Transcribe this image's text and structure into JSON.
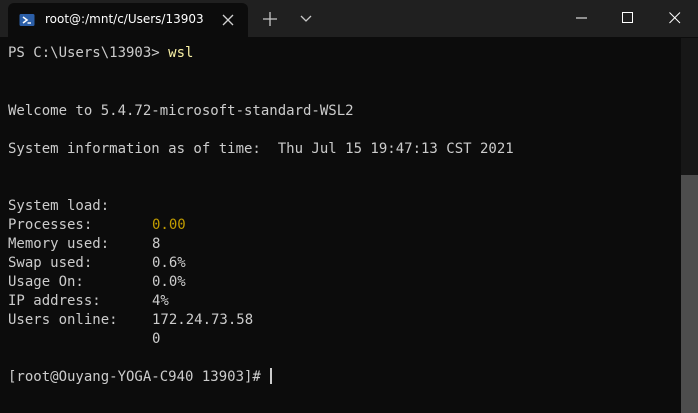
{
  "window": {
    "tab_title": "root@:/mnt/c/Users/13903",
    "icons": {
      "tab": "powershell-icon",
      "tab_close": "close-icon",
      "new_tab": "plus-icon",
      "dropdown": "chevron-down-icon",
      "minimize": "minimize-icon",
      "maximize": "maximize-icon",
      "close": "close-icon"
    }
  },
  "terminal": {
    "prompt_ps": "PS C:\\Users\\13903> ",
    "command": "wsl",
    "welcome": "Welcome to 5.4.72-microsoft-standard-WSL2",
    "sysinfo": "System information as of time:  Thu Jul 15 19:47:13 CST 2021",
    "info": [
      {
        "key": "System load:",
        "value": "0.00",
        "highlight": true
      },
      {
        "key": "Processes:",
        "value": "8",
        "highlight": false
      },
      {
        "key": "Memory used:",
        "value": "0.6%",
        "highlight": false
      },
      {
        "key": "Swap used:",
        "value": "0.0%",
        "highlight": false
      },
      {
        "key": "Usage On:",
        "value": "4%",
        "highlight": false
      },
      {
        "key": "IP address:",
        "value": "172.24.73.58",
        "highlight": false
      },
      {
        "key": "Users online:",
        "value": "0",
        "highlight": false
      }
    ],
    "final_prompt": "[root@Ouyang-YOGA-C940 13903]# "
  },
  "colors": {
    "background": "#0c0c0c",
    "titlebar": "#202020",
    "text": "#cccccc",
    "command": "#f9f1a5",
    "highlight": "#c19c00"
  }
}
